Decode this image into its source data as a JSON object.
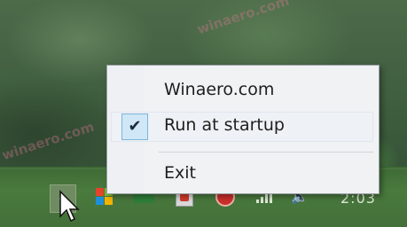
{
  "context_menu": {
    "items": [
      {
        "label": "Winaero.com"
      },
      {
        "label": "Run at startup",
        "checked": true
      },
      {
        "label": "Exit"
      }
    ]
  },
  "taskbar": {
    "clock_text": "2:03",
    "tray_icons": [
      "show-hidden-icons",
      "windows-logo-icon",
      "green-app-icon",
      "red-app-icon",
      "red-circle-icon",
      "signal-icon",
      "volume-icon"
    ]
  },
  "colors": {
    "menu_bg": "#f1f2f4",
    "check_bg": "#cfe7f6",
    "taskbar": "#436f38",
    "accent_red": "#c9302c"
  }
}
